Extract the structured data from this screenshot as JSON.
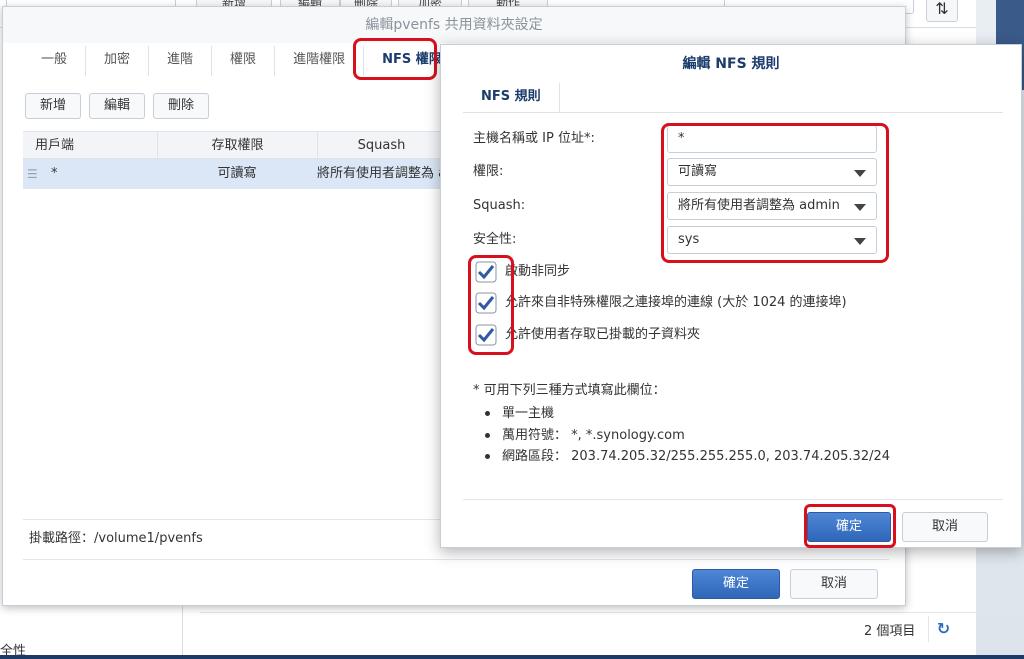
{
  "background": {
    "toolbar_buttons": [
      "新增",
      "編輯",
      "刪除",
      "加密",
      "動作"
    ],
    "sort_icon": "sort-icon",
    "item_count": "2 個項目",
    "refresh_icon": "refresh-icon",
    "side_text": "全性"
  },
  "main_dialog": {
    "title": "編輯pvenfs 共用資料夾設定",
    "tabs": [
      {
        "label": "一般"
      },
      {
        "label": "加密"
      },
      {
        "label": "進階"
      },
      {
        "label": "權限"
      },
      {
        "label": "進階權限"
      },
      {
        "label": "NFS 權限"
      }
    ],
    "toolbar": {
      "add": "新增",
      "edit": "編輯",
      "delete": "刪除"
    },
    "grid": {
      "headers": [
        "用戶端",
        "存取權限",
        "Squash"
      ],
      "rows": [
        {
          "client": "*",
          "access": "可讀寫",
          "squash": "將所有使用者調整為 admin"
        }
      ]
    },
    "mount_path": "掛載路徑：/volume1/pvenfs",
    "ok": "確定",
    "cancel": "取消"
  },
  "nfs_dialog": {
    "title": "編輯 NFS 規則",
    "tab": "NFS 規則",
    "host_label": "主機名稱或 IP 位址*:",
    "host_value": "*",
    "privilege_label": "權限:",
    "privilege_value": "可讀寫",
    "squash_label": "Squash:",
    "squash_value": "將所有使用者調整為 admin",
    "security_label": "安全性:",
    "security_value": "sys",
    "checkboxes": [
      {
        "label": "啟動非同步",
        "checked": true
      },
      {
        "label": "允許來自非特殊權限之連接埠的連線 (大於 1024 的連接埠)",
        "checked": true
      },
      {
        "label": "允許使用者存取已掛載的子資料夾",
        "checked": true
      }
    ],
    "note_title": "* 可用下列三種方式填寫此欄位：",
    "note_items": [
      "單一主機",
      "萬用符號： *, *.synology.com",
      "網路區段： 203.74.205.32/255.255.255.0, 203.74.205.32/24"
    ],
    "ok": "確定",
    "cancel": "取消"
  },
  "colors": {
    "highlight": "#d8101e",
    "primary": "#2f66b8",
    "title_text": "#1c3c6c"
  }
}
